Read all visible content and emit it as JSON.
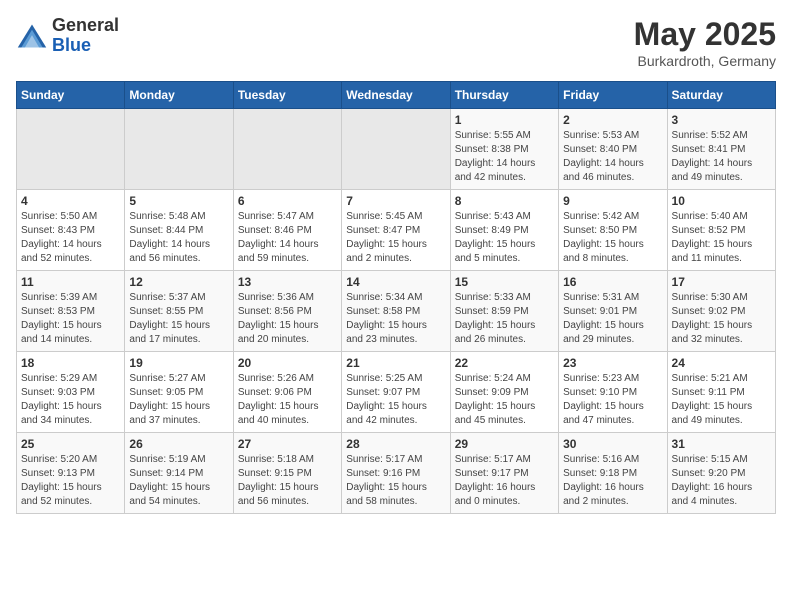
{
  "header": {
    "logo": {
      "general": "General",
      "blue": "Blue"
    },
    "title": "May 2025",
    "subtitle": "Burkardroth, Germany"
  },
  "weekdays": [
    "Sunday",
    "Monday",
    "Tuesday",
    "Wednesday",
    "Thursday",
    "Friday",
    "Saturday"
  ],
  "weeks": [
    [
      {
        "day": "",
        "info": ""
      },
      {
        "day": "",
        "info": ""
      },
      {
        "day": "",
        "info": ""
      },
      {
        "day": "",
        "info": ""
      },
      {
        "day": "1",
        "info": "Sunrise: 5:55 AM\nSunset: 8:38 PM\nDaylight: 14 hours\nand 42 minutes."
      },
      {
        "day": "2",
        "info": "Sunrise: 5:53 AM\nSunset: 8:40 PM\nDaylight: 14 hours\nand 46 minutes."
      },
      {
        "day": "3",
        "info": "Sunrise: 5:52 AM\nSunset: 8:41 PM\nDaylight: 14 hours\nand 49 minutes."
      }
    ],
    [
      {
        "day": "4",
        "info": "Sunrise: 5:50 AM\nSunset: 8:43 PM\nDaylight: 14 hours\nand 52 minutes."
      },
      {
        "day": "5",
        "info": "Sunrise: 5:48 AM\nSunset: 8:44 PM\nDaylight: 14 hours\nand 56 minutes."
      },
      {
        "day": "6",
        "info": "Sunrise: 5:47 AM\nSunset: 8:46 PM\nDaylight: 14 hours\nand 59 minutes."
      },
      {
        "day": "7",
        "info": "Sunrise: 5:45 AM\nSunset: 8:47 PM\nDaylight: 15 hours\nand 2 minutes."
      },
      {
        "day": "8",
        "info": "Sunrise: 5:43 AM\nSunset: 8:49 PM\nDaylight: 15 hours\nand 5 minutes."
      },
      {
        "day": "9",
        "info": "Sunrise: 5:42 AM\nSunset: 8:50 PM\nDaylight: 15 hours\nand 8 minutes."
      },
      {
        "day": "10",
        "info": "Sunrise: 5:40 AM\nSunset: 8:52 PM\nDaylight: 15 hours\nand 11 minutes."
      }
    ],
    [
      {
        "day": "11",
        "info": "Sunrise: 5:39 AM\nSunset: 8:53 PM\nDaylight: 15 hours\nand 14 minutes."
      },
      {
        "day": "12",
        "info": "Sunrise: 5:37 AM\nSunset: 8:55 PM\nDaylight: 15 hours\nand 17 minutes."
      },
      {
        "day": "13",
        "info": "Sunrise: 5:36 AM\nSunset: 8:56 PM\nDaylight: 15 hours\nand 20 minutes."
      },
      {
        "day": "14",
        "info": "Sunrise: 5:34 AM\nSunset: 8:58 PM\nDaylight: 15 hours\nand 23 minutes."
      },
      {
        "day": "15",
        "info": "Sunrise: 5:33 AM\nSunset: 8:59 PM\nDaylight: 15 hours\nand 26 minutes."
      },
      {
        "day": "16",
        "info": "Sunrise: 5:31 AM\nSunset: 9:01 PM\nDaylight: 15 hours\nand 29 minutes."
      },
      {
        "day": "17",
        "info": "Sunrise: 5:30 AM\nSunset: 9:02 PM\nDaylight: 15 hours\nand 32 minutes."
      }
    ],
    [
      {
        "day": "18",
        "info": "Sunrise: 5:29 AM\nSunset: 9:03 PM\nDaylight: 15 hours\nand 34 minutes."
      },
      {
        "day": "19",
        "info": "Sunrise: 5:27 AM\nSunset: 9:05 PM\nDaylight: 15 hours\nand 37 minutes."
      },
      {
        "day": "20",
        "info": "Sunrise: 5:26 AM\nSunset: 9:06 PM\nDaylight: 15 hours\nand 40 minutes."
      },
      {
        "day": "21",
        "info": "Sunrise: 5:25 AM\nSunset: 9:07 PM\nDaylight: 15 hours\nand 42 minutes."
      },
      {
        "day": "22",
        "info": "Sunrise: 5:24 AM\nSunset: 9:09 PM\nDaylight: 15 hours\nand 45 minutes."
      },
      {
        "day": "23",
        "info": "Sunrise: 5:23 AM\nSunset: 9:10 PM\nDaylight: 15 hours\nand 47 minutes."
      },
      {
        "day": "24",
        "info": "Sunrise: 5:21 AM\nSunset: 9:11 PM\nDaylight: 15 hours\nand 49 minutes."
      }
    ],
    [
      {
        "day": "25",
        "info": "Sunrise: 5:20 AM\nSunset: 9:13 PM\nDaylight: 15 hours\nand 52 minutes."
      },
      {
        "day": "26",
        "info": "Sunrise: 5:19 AM\nSunset: 9:14 PM\nDaylight: 15 hours\nand 54 minutes."
      },
      {
        "day": "27",
        "info": "Sunrise: 5:18 AM\nSunset: 9:15 PM\nDaylight: 15 hours\nand 56 minutes."
      },
      {
        "day": "28",
        "info": "Sunrise: 5:17 AM\nSunset: 9:16 PM\nDaylight: 15 hours\nand 58 minutes."
      },
      {
        "day": "29",
        "info": "Sunrise: 5:17 AM\nSunset: 9:17 PM\nDaylight: 16 hours\nand 0 minutes."
      },
      {
        "day": "30",
        "info": "Sunrise: 5:16 AM\nSunset: 9:18 PM\nDaylight: 16 hours\nand 2 minutes."
      },
      {
        "day": "31",
        "info": "Sunrise: 5:15 AM\nSunset: 9:20 PM\nDaylight: 16 hours\nand 4 minutes."
      }
    ]
  ]
}
